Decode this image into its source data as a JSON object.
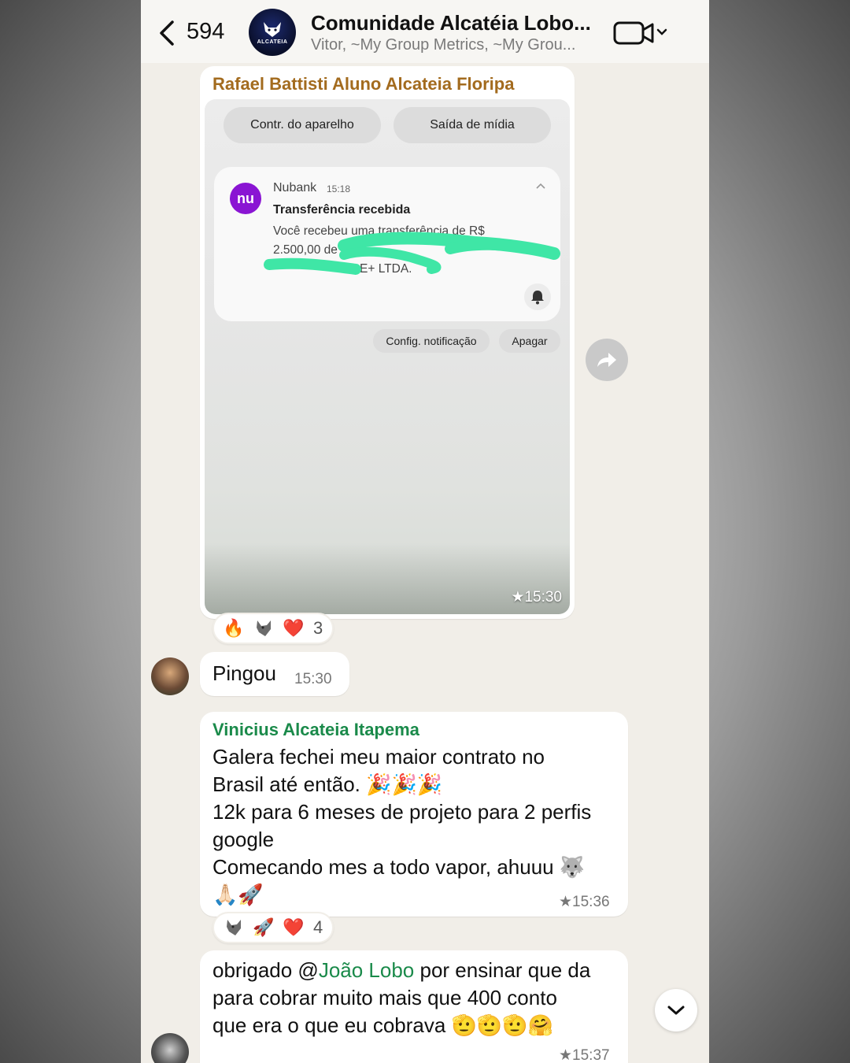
{
  "header": {
    "unread_count": "594",
    "group_name": "Comunidade Alcatéia Lobo...",
    "participants": "Vitor, ~My Group Metrics, ~My Grou...",
    "avatar_text": "ALCATEIA"
  },
  "messages": {
    "image_msg": {
      "sender": "Rafael Battisti Aluno Alcateia Floripa",
      "time": "★15:30",
      "screenshot": {
        "pill_left": "Contr. do aparelho",
        "pill_right": "Saída de mídia",
        "notif_app": "Nubank",
        "notif_time": "15:18",
        "notif_logo": "nu",
        "notif_title": "Transferência recebida",
        "notif_line1": "Você recebeu uma transferência de R$",
        "notif_line2": "2.500,00 de",
        "notif_line3": "E+ LTDA.",
        "btn_config": "Config. notificação",
        "btn_delete": "Apagar"
      },
      "reactions": {
        "count": "3",
        "emojis": [
          "🔥",
          "wolf",
          "❤️"
        ]
      }
    },
    "pingou": {
      "text": "Pingou",
      "time": "15:30"
    },
    "vinicius": {
      "sender": "Vinicius Alcateia Itapema",
      "line1": "Galera fechei meu maior contrato no",
      "line2": "Brasil até então. 🎉🎉🎉",
      "line3": "12k para 6 meses de projeto para 2 perfis",
      "line4": "google",
      "line5": "Comecando mes a todo vapor, ahuuu 🐺",
      "line6": "🙏🏻🚀",
      "time": "★15:36",
      "reactions": {
        "count": "4",
        "emojis": [
          "wolf",
          "🚀",
          "❤️"
        ]
      }
    },
    "obrigado": {
      "prefix": "obrigado @",
      "mention": "João Lobo",
      "rest1": " por ensinar que da",
      "line2": "para cobrar muito mais que 400 conto",
      "line3": "que era o que eu cobrava 🫡🫡🫡🤗",
      "time": "★15:37"
    }
  },
  "colors": {
    "chat_bg": "#f1eee8",
    "sender_rafael": "#a36b1e",
    "sender_vinicius": "#1a8a4a",
    "nubank_purple": "#8a15d3",
    "redaction_green": "#3fe6a6"
  },
  "icons": [
    "back-chevron-icon",
    "video-call-icon",
    "forward-icon",
    "scroll-down-icon",
    "bell-icon",
    "chevron-up-icon"
  ]
}
